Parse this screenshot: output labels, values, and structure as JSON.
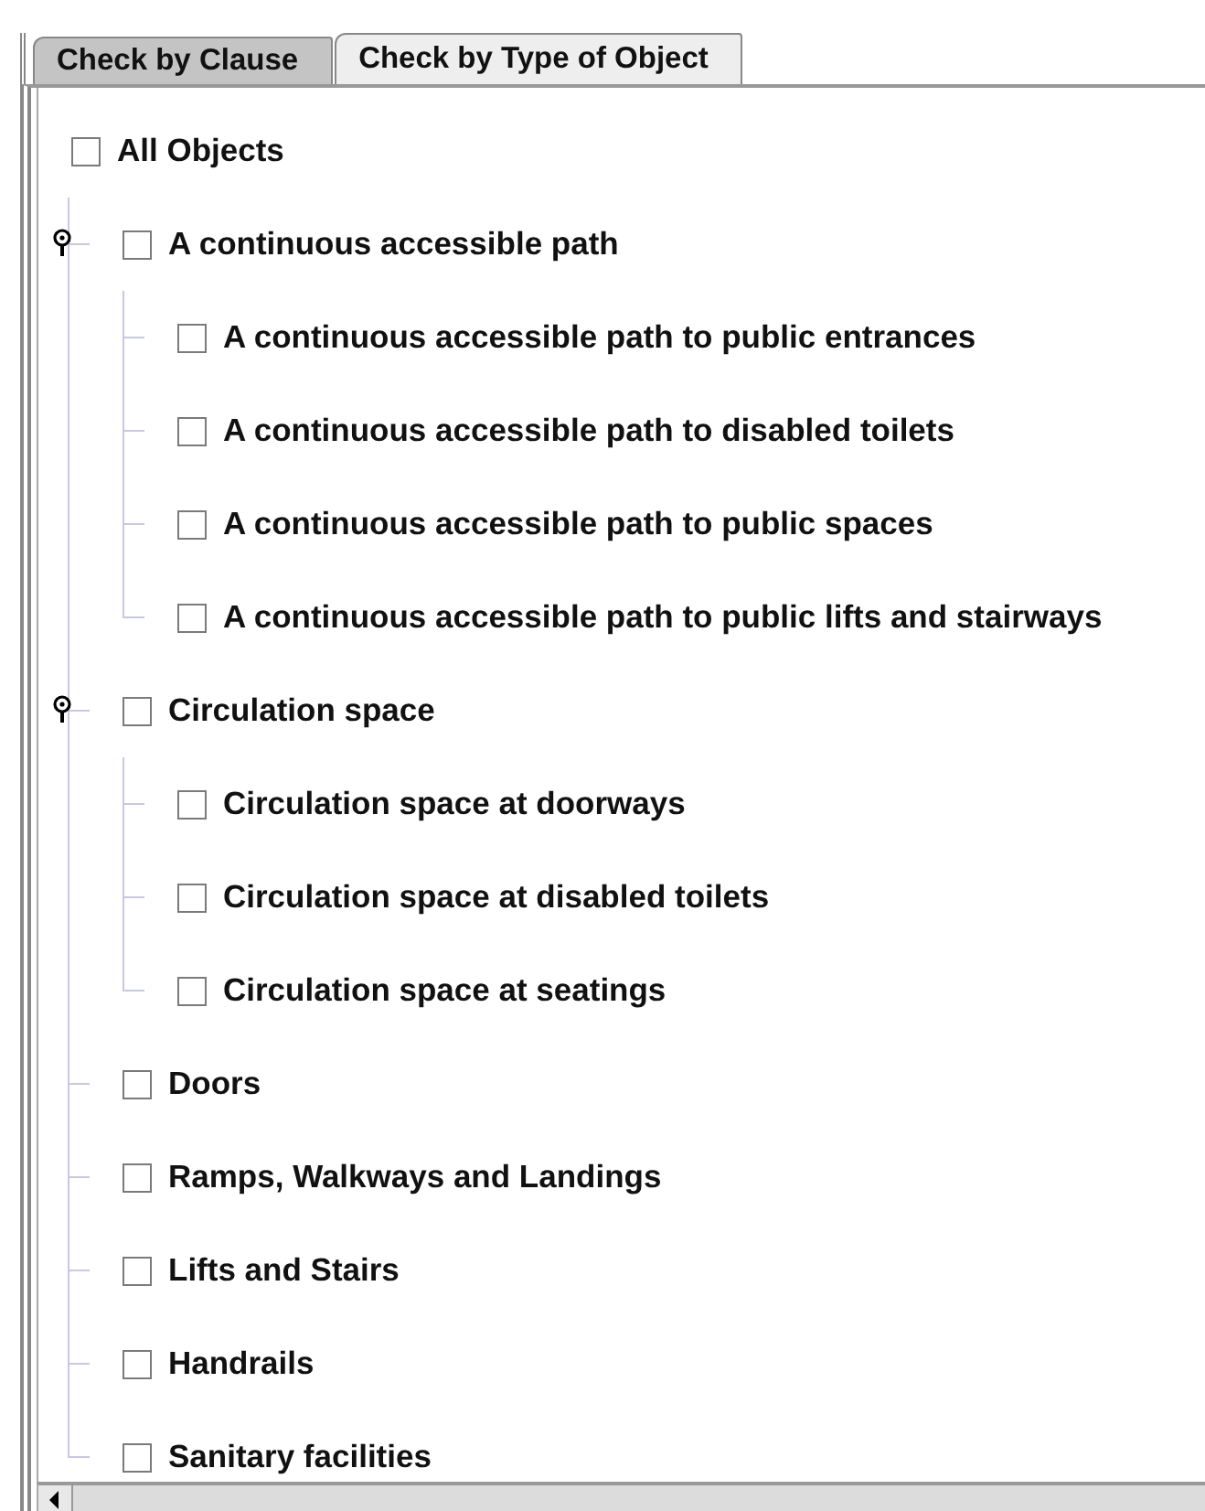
{
  "tabs": [
    {
      "label": "Check by Clause",
      "selected": false
    },
    {
      "label": "Check by Type of Object",
      "selected": true
    }
  ],
  "tree": {
    "label": "All Objects",
    "checked": false,
    "children": [
      {
        "label": "A continuous accessible path",
        "checked": false,
        "expanded": true,
        "children": [
          {
            "label": "A continuous accessible path to public entrances",
            "checked": false
          },
          {
            "label": "A continuous accessible path to disabled toilets",
            "checked": false
          },
          {
            "label": "A continuous accessible path to public spaces",
            "checked": false
          },
          {
            "label": "A continuous accessible path to public lifts and stairways",
            "checked": false
          }
        ]
      },
      {
        "label": "Circulation space",
        "checked": false,
        "expanded": true,
        "children": [
          {
            "label": "Circulation space at doorways",
            "checked": false
          },
          {
            "label": "Circulation space at disabled toilets",
            "checked": false
          },
          {
            "label": "Circulation space at seatings",
            "checked": false
          }
        ]
      },
      {
        "label": "Doors",
        "checked": false
      },
      {
        "label": "Ramps, Walkways and Landings",
        "checked": false
      },
      {
        "label": "Lifts and Stairs",
        "checked": false
      },
      {
        "label": "Handrails",
        "checked": false
      },
      {
        "label": "Sanitary facilities",
        "checked": false
      }
    ]
  }
}
